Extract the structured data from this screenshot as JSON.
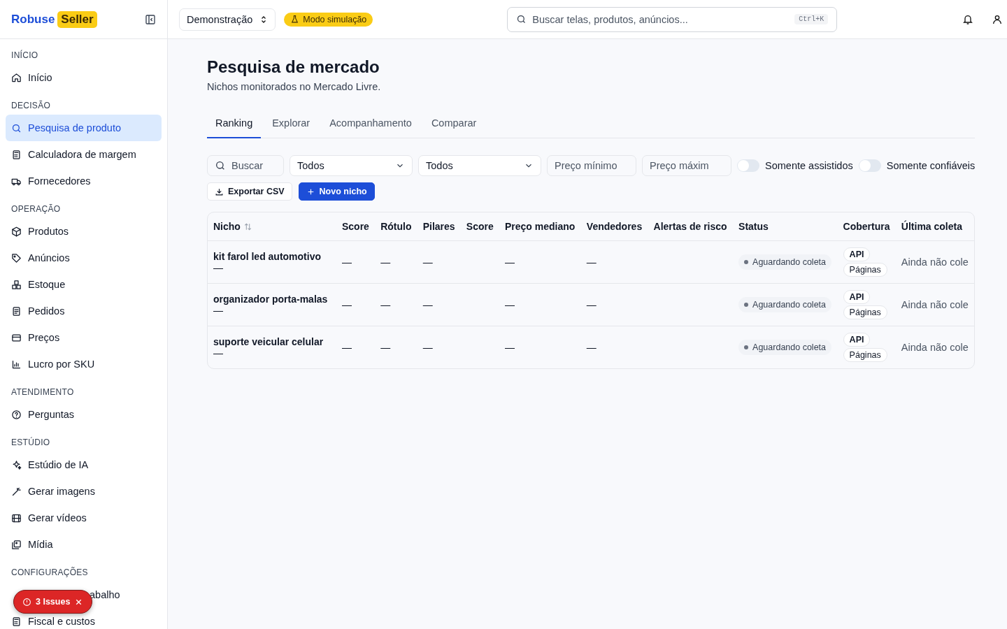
{
  "brand": {
    "name": "Robuse",
    "badge": "Seller"
  },
  "sidebar": {
    "sections": [
      {
        "title": "INÍCIO",
        "items": [
          {
            "label": "Início",
            "selected": false
          }
        ]
      },
      {
        "title": "DECISÃO",
        "items": [
          {
            "label": "Pesquisa de produto",
            "selected": true
          },
          {
            "label": "Calculadora de margem",
            "selected": false
          },
          {
            "label": "Fornecedores",
            "selected": false
          }
        ]
      },
      {
        "title": "OPERAÇÃO",
        "items": [
          {
            "label": "Produtos",
            "selected": false
          },
          {
            "label": "Anúncios",
            "selected": false
          },
          {
            "label": "Estoque",
            "selected": false
          },
          {
            "label": "Pedidos",
            "selected": false
          },
          {
            "label": "Preços",
            "selected": false
          },
          {
            "label": "Lucro por SKU",
            "selected": false
          }
        ]
      },
      {
        "title": "ATENDIMENTO",
        "items": [
          {
            "label": "Perguntas",
            "selected": false
          }
        ]
      },
      {
        "title": "ESTÚDIO",
        "items": [
          {
            "label": "Estúdio de IA",
            "selected": false
          },
          {
            "label": "Gerar imagens",
            "selected": false
          },
          {
            "label": "Gerar vídeos",
            "selected": false
          },
          {
            "label": "Mídia",
            "selected": false
          }
        ]
      },
      {
        "title": "CONFIGURAÇÕES",
        "items": [
          {
            "label": "abalho",
            "selected": false,
            "covered": true
          },
          {
            "label": "Fiscal e custos",
            "selected": false
          }
        ]
      }
    ]
  },
  "issues_badge": {
    "label": "3 Issues"
  },
  "topbar": {
    "workspace": "Demonstração",
    "mode_badge": "Modo simulação",
    "search": {
      "placeholder": "Buscar telas, produtos, anúncios...",
      "shortcut": "Ctrl+K"
    }
  },
  "page": {
    "title": "Pesquisa de mercado",
    "subtitle": "Nichos monitorados no Mercado Livre."
  },
  "tabs": [
    {
      "label": "Ranking",
      "selected": true
    },
    {
      "label": "Explorar",
      "selected": false
    },
    {
      "label": "Acompanhamento",
      "selected": false
    },
    {
      "label": "Comparar",
      "selected": false
    }
  ],
  "filters": {
    "search": {
      "placeholder": "Buscar"
    },
    "selects": [
      {
        "value": "Todos"
      },
      {
        "value": "Todos"
      }
    ],
    "min_price": {
      "placeholder": "Preço mínimo"
    },
    "max_price": {
      "placeholder": "Preço máxim"
    },
    "toggles": [
      {
        "label": "Somente assistidos",
        "on": false
      },
      {
        "label": "Somente confiáveis",
        "on": false
      }
    ]
  },
  "actions": [
    {
      "label": "Exportar CSV",
      "kind": "export"
    },
    {
      "label": "Novo nicho",
      "kind": "primary"
    }
  ],
  "table": {
    "columns": [
      "Nicho",
      "Score",
      "Rótulo",
      "Pilares",
      "Score",
      "Preço mediano",
      "Vendedores",
      "Alertas de risco",
      "Status",
      "Cobertura",
      "Última coleta"
    ],
    "rows": [
      {
        "nicho": "kit farol led automotivo",
        "sub": "—",
        "score": "—",
        "rotulo": "—",
        "pilares": "—",
        "preco": "—",
        "vendedores": "—",
        "status": "Aguardando coleta",
        "cobertura": [
          "API",
          "Páginas"
        ],
        "ultima": "Ainda não cole"
      },
      {
        "nicho": "organizador porta-malas",
        "sub": "—",
        "score": "—",
        "rotulo": "—",
        "pilares": "—",
        "preco": "—",
        "vendedores": "—",
        "status": "Aguardando coleta",
        "cobertura": [
          "API",
          "Páginas"
        ],
        "ultima": "Ainda não cole"
      },
      {
        "nicho": "suporte veicular celular",
        "sub": "—",
        "score": "—",
        "rotulo": "—",
        "pilares": "—",
        "preco": "—",
        "vendedores": "—",
        "status": "Aguardando coleta",
        "cobertura": [
          "API",
          "Páginas"
        ],
        "ultima": "Ainda não cole"
      }
    ]
  }
}
